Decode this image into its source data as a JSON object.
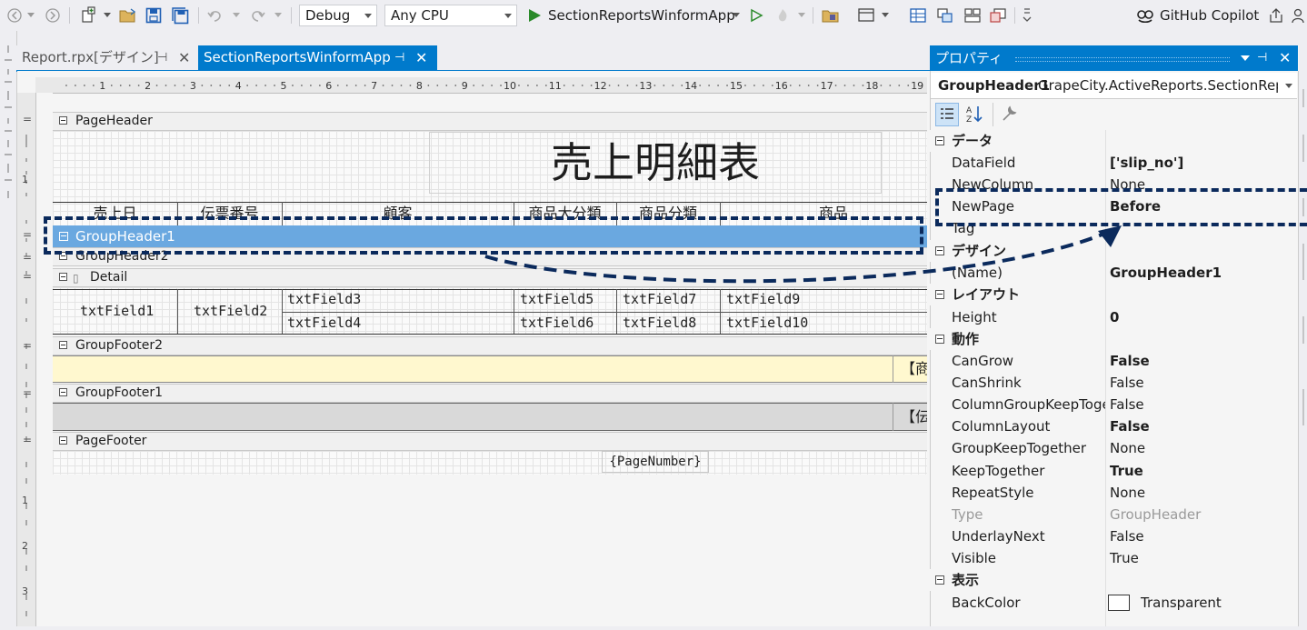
{
  "toolbar": {
    "config": "Debug",
    "platform": "Any CPU",
    "run_target": "SectionReportsWinformApp",
    "copilot": "GitHub Copilot"
  },
  "tabs": [
    {
      "label": "Report.rpx[デザイン]",
      "active": false
    },
    {
      "label": "SectionReportsWinformApp",
      "active": true
    }
  ],
  "ruler_numbers": [
    "1",
    "2",
    "3",
    "4",
    "5",
    "6",
    "7",
    "8",
    "9",
    "10",
    "11",
    "12",
    "13",
    "14",
    "15",
    "16",
    "17",
    "18",
    "19"
  ],
  "report": {
    "title": "売上明細表",
    "column_headers": [
      "売上日",
      "伝票番号",
      "顧客",
      "商品大分類",
      "商品分類",
      "商品"
    ],
    "bands": {
      "page_header": "PageHeader",
      "group_header1": "GroupHeader1",
      "group_header2": "GroupHeader2",
      "detail": "Detail",
      "group_footer2": "GroupFooter2",
      "group_footer1": "GroupFooter1",
      "page_footer": "PageFooter"
    },
    "fields": {
      "f1": "txtField1",
      "f2": "txtField2",
      "f3": "txtField3",
      "f4": "txtField4",
      "f5": "txtField5",
      "f6": "txtField6",
      "f7": "txtField7",
      "f8": "txtField8",
      "f9": "txtField9",
      "f10": "txtField10"
    },
    "footer2_text": "【商品",
    "footer1_text": "【伝",
    "page_number": "{PageNumber}"
  },
  "properties": {
    "panel_title": "プロパティ",
    "object_name": "GroupHeader1",
    "object_type": "GrapeCity.ActiveReports.SectionRepo",
    "categories": {
      "data": "データ",
      "design": "デザイン",
      "layout": "レイアウト",
      "behavior": "動作",
      "display": "表示"
    },
    "rows": {
      "datafield": {
        "name": "DataField",
        "value": "['slip_no']"
      },
      "newcolumn": {
        "name": "NewColumn",
        "value": "None"
      },
      "newpage": {
        "name": "NewPage",
        "value": "Before"
      },
      "tag": {
        "name": "Tag",
        "value": ""
      },
      "name": {
        "name": "(Name)",
        "value": "GroupHeader1"
      },
      "height": {
        "name": "Height",
        "value": "0"
      },
      "cangrow": {
        "name": "CanGrow",
        "value": "False"
      },
      "canshrink": {
        "name": "CanShrink",
        "value": "False"
      },
      "colgroupkeep": {
        "name": "ColumnGroupKeepTogether",
        "value": "False"
      },
      "columnlayout": {
        "name": "ColumnLayout",
        "value": "False"
      },
      "groupkeep": {
        "name": "GroupKeepTogether",
        "value": "None"
      },
      "keeptogether": {
        "name": "KeepTogether",
        "value": "True"
      },
      "repeatstyle": {
        "name": "RepeatStyle",
        "value": "None"
      },
      "type": {
        "name": "Type",
        "value": "GroupHeader"
      },
      "underlay": {
        "name": "UnderlayNext",
        "value": "False"
      },
      "visible": {
        "name": "Visible",
        "value": "True"
      },
      "backcolor": {
        "name": "BackColor",
        "value": "Transparent"
      }
    }
  },
  "colors": {
    "accent": "#007acc",
    "selected_band": "#6aa8e0",
    "annotation": "#0b2a5c",
    "footer2_bg": "#fff8cf",
    "footer1_bg": "#d9d9d9"
  }
}
